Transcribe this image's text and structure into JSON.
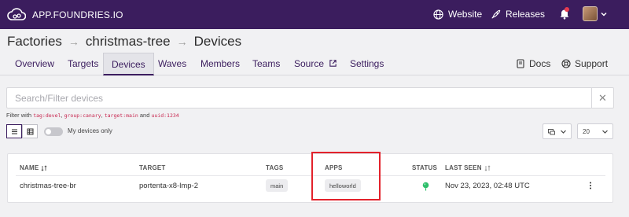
{
  "brand": {
    "name": "APP.FOUNDRIES.IO"
  },
  "topbar": {
    "website_label": "Website",
    "releases_label": "Releases"
  },
  "breadcrumb": {
    "items": [
      "Factories",
      "christmas-tree",
      "Devices"
    ],
    "separator": "→"
  },
  "tabs": {
    "items": [
      "Overview",
      "Targets",
      "Devices",
      "Waves",
      "Members",
      "Teams",
      "Source",
      "Settings"
    ],
    "active": "Devices",
    "right": [
      "Docs",
      "Support"
    ]
  },
  "search": {
    "placeholder": "Search/Filter devices",
    "value": "",
    "clear_icon": "✕"
  },
  "filter_hint": {
    "prefix": "Filter with",
    "examples": [
      "tag:devel",
      "group:canary",
      "target:main"
    ],
    "conjunction": "and",
    "last_example": "uuid:1234"
  },
  "view_controls": {
    "my_devices_label": "My devices only",
    "my_devices_enabled": false,
    "page_size": "20"
  },
  "table": {
    "headers": {
      "name": "NAME",
      "target": "TARGET",
      "tags": "TAGS",
      "apps": "APPS",
      "status": "STATUS",
      "last_seen": "LAST SEEN"
    },
    "rows": [
      {
        "name": "christmas-tree-br",
        "target": "portenta-x8-lmp-2",
        "tags": "main",
        "apps": "helloworld",
        "status": "online",
        "last_seen": "Nov 23, 2023, 02:48 UTC"
      }
    ]
  },
  "colors": {
    "header_bg": "#3b1d5e",
    "accent": "#3b1d5e",
    "notification_dot": "#e83a4f",
    "status_online": "#2fbf6b",
    "highlight": "#e3222b"
  }
}
